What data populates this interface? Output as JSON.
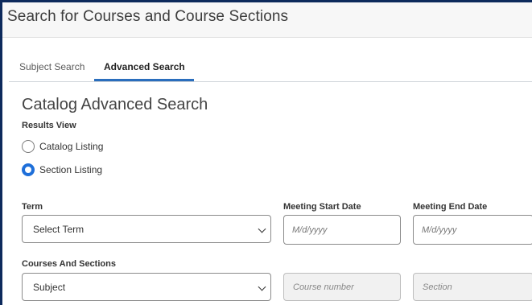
{
  "header": {
    "title": "Search for Courses and Course Sections"
  },
  "tabs": [
    {
      "label": "Subject Search",
      "active": false
    },
    {
      "label": "Advanced Search",
      "active": true
    }
  ],
  "catalog": {
    "title": "Catalog Advanced Search"
  },
  "results_view": {
    "label": "Results View",
    "options": [
      {
        "label": "Catalog Listing",
        "selected": false
      },
      {
        "label": "Section Listing",
        "selected": true
      }
    ]
  },
  "term": {
    "label": "Term",
    "value": "Select Term"
  },
  "meeting_start": {
    "label": "Meeting Start Date",
    "placeholder": "M/d/yyyy"
  },
  "meeting_end": {
    "label": "Meeting End Date",
    "placeholder": "M/d/yyyy"
  },
  "courses_sections": {
    "label": "Courses And Sections",
    "subject_value": "Subject",
    "course_number_placeholder": "Course number",
    "section_placeholder": "Section"
  },
  "colors": {
    "accent": "#2a6ebd",
    "radio_selected": "#1e6fd9",
    "frame": "#0d2a5c"
  }
}
